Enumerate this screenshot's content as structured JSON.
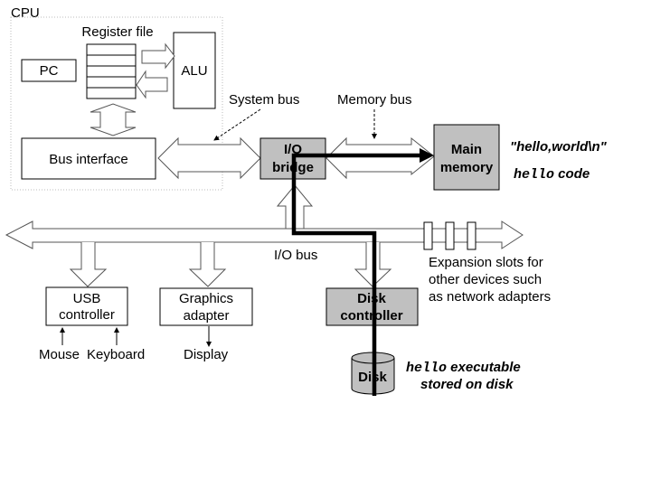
{
  "colors": {
    "component_fill": "#c0c0c0",
    "outline": "#000000",
    "bus_outline": "#555555",
    "data_path": "#000000"
  },
  "labels": {
    "cpu": "CPU",
    "register_file": "Register file",
    "pc": "PC",
    "alu": "ALU",
    "bus_interface": "Bus interface",
    "system_bus": "System bus",
    "memory_bus": "Memory bus",
    "io_bridge_line1": "I/O",
    "io_bridge_line2": "bridge",
    "main_memory_line1": "Main",
    "main_memory_line2": "memory",
    "hello_world_string": "\"hello,world\\n\"",
    "hello_mono": "hello",
    "code": " code",
    "io_bus": "I/O bus",
    "expansion_line1": "Expansion slots for",
    "expansion_line2": "other devices such",
    "expansion_line3": "as network adapters",
    "usb_line1": "USB",
    "usb_line2": "controller",
    "graphics_line1": "Graphics",
    "graphics_line2": "adapter",
    "disk_controller_line1": "Disk",
    "disk_controller_line2": "controller",
    "mouse": "Mouse",
    "keyboard": "Keyboard",
    "display": "Display",
    "disk": "Disk",
    "executable": " executable",
    "stored_on_disk": "stored on disk"
  }
}
